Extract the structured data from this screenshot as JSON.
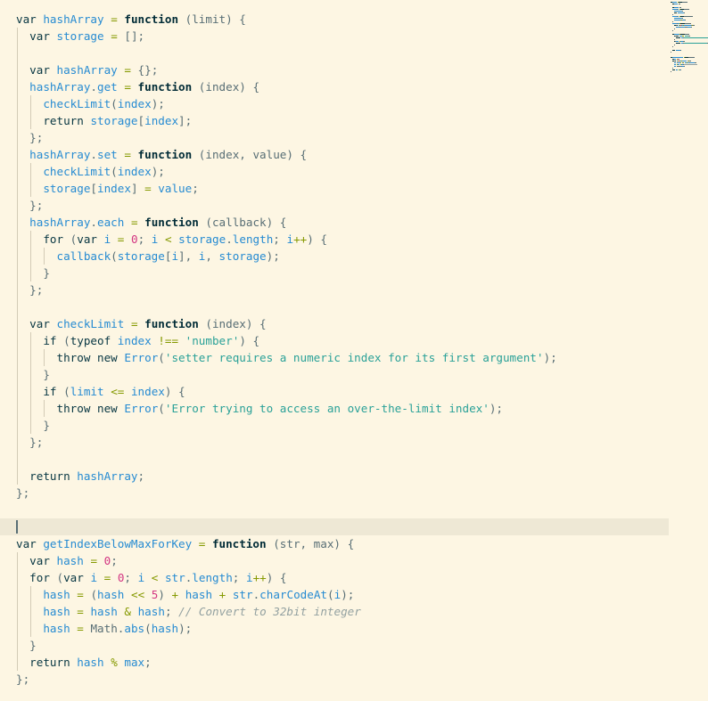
{
  "editor": {
    "theme": "solarized-light",
    "colors": {
      "background": "#fdf6e3",
      "current_line": "#eee8d5",
      "keyword": "#073642",
      "identifier": "#268bd2",
      "string": "#2aa198",
      "number": "#d33682",
      "operator": "#859900",
      "comment": "#93a1a1",
      "text": "#586e75"
    },
    "cursor_line": 30,
    "lines": [
      {
        "indent": 0,
        "tokens": [
          [
            "kw",
            "var"
          ],
          [
            "p",
            " "
          ],
          [
            "id",
            "hashArray"
          ],
          [
            "p",
            " "
          ],
          [
            "op",
            "="
          ],
          [
            "p",
            " "
          ],
          [
            "fk",
            "function"
          ],
          [
            "p",
            " (limit) {"
          ]
        ]
      },
      {
        "indent": 1,
        "tokens": [
          [
            "kw",
            "var"
          ],
          [
            "p",
            " "
          ],
          [
            "id",
            "storage"
          ],
          [
            "p",
            " "
          ],
          [
            "op",
            "="
          ],
          [
            "p",
            " [];"
          ]
        ]
      },
      {
        "indent": 1,
        "tokens": []
      },
      {
        "indent": 1,
        "tokens": [
          [
            "kw",
            "var"
          ],
          [
            "p",
            " "
          ],
          [
            "id",
            "hashArray"
          ],
          [
            "p",
            " "
          ],
          [
            "op",
            "="
          ],
          [
            "p",
            " {};"
          ]
        ]
      },
      {
        "indent": 1,
        "tokens": [
          [
            "id",
            "hashArray"
          ],
          [
            "p",
            "."
          ],
          [
            "id",
            "get"
          ],
          [
            "p",
            " "
          ],
          [
            "op",
            "="
          ],
          [
            "p",
            " "
          ],
          [
            "fk",
            "function"
          ],
          [
            "p",
            " (index) {"
          ]
        ]
      },
      {
        "indent": 2,
        "tokens": [
          [
            "id",
            "checkLimit"
          ],
          [
            "p",
            "("
          ],
          [
            "id",
            "index"
          ],
          [
            "p",
            ");"
          ]
        ]
      },
      {
        "indent": 2,
        "tokens": [
          [
            "kw",
            "return"
          ],
          [
            "p",
            " "
          ],
          [
            "id",
            "storage"
          ],
          [
            "p",
            "["
          ],
          [
            "id",
            "index"
          ],
          [
            "p",
            "];"
          ]
        ]
      },
      {
        "indent": 1,
        "tokens": [
          [
            "p",
            "};"
          ]
        ]
      },
      {
        "indent": 1,
        "tokens": [
          [
            "id",
            "hashArray"
          ],
          [
            "p",
            "."
          ],
          [
            "id",
            "set"
          ],
          [
            "p",
            " "
          ],
          [
            "op",
            "="
          ],
          [
            "p",
            " "
          ],
          [
            "fk",
            "function"
          ],
          [
            "p",
            " (index, value) {"
          ]
        ]
      },
      {
        "indent": 2,
        "tokens": [
          [
            "id",
            "checkLimit"
          ],
          [
            "p",
            "("
          ],
          [
            "id",
            "index"
          ],
          [
            "p",
            ");"
          ]
        ]
      },
      {
        "indent": 2,
        "tokens": [
          [
            "id",
            "storage"
          ],
          [
            "p",
            "["
          ],
          [
            "id",
            "index"
          ],
          [
            "p",
            "] "
          ],
          [
            "op",
            "="
          ],
          [
            "p",
            " "
          ],
          [
            "id",
            "value"
          ],
          [
            "p",
            ";"
          ]
        ]
      },
      {
        "indent": 1,
        "tokens": [
          [
            "p",
            "};"
          ]
        ]
      },
      {
        "indent": 1,
        "tokens": [
          [
            "id",
            "hashArray"
          ],
          [
            "p",
            "."
          ],
          [
            "id",
            "each"
          ],
          [
            "p",
            " "
          ],
          [
            "op",
            "="
          ],
          [
            "p",
            " "
          ],
          [
            "fk",
            "function"
          ],
          [
            "p",
            " (callback) {"
          ]
        ]
      },
      {
        "indent": 2,
        "tokens": [
          [
            "kw",
            "for"
          ],
          [
            "p",
            " ("
          ],
          [
            "kw",
            "var"
          ],
          [
            "p",
            " "
          ],
          [
            "id",
            "i"
          ],
          [
            "p",
            " "
          ],
          [
            "op",
            "="
          ],
          [
            "p",
            " "
          ],
          [
            "num",
            "0"
          ],
          [
            "p",
            "; "
          ],
          [
            "id",
            "i"
          ],
          [
            "p",
            " "
          ],
          [
            "op",
            "<"
          ],
          [
            "p",
            " "
          ],
          [
            "id",
            "storage"
          ],
          [
            "p",
            "."
          ],
          [
            "id",
            "length"
          ],
          [
            "p",
            "; "
          ],
          [
            "id",
            "i"
          ],
          [
            "op",
            "++"
          ],
          [
            "p",
            ") {"
          ]
        ]
      },
      {
        "indent": 3,
        "tokens": [
          [
            "id",
            "callback"
          ],
          [
            "p",
            "("
          ],
          [
            "id",
            "storage"
          ],
          [
            "p",
            "["
          ],
          [
            "id",
            "i"
          ],
          [
            "p",
            "], "
          ],
          [
            "id",
            "i"
          ],
          [
            "p",
            ", "
          ],
          [
            "id",
            "storage"
          ],
          [
            "p",
            ");"
          ]
        ]
      },
      {
        "indent": 2,
        "tokens": [
          [
            "p",
            "}"
          ]
        ]
      },
      {
        "indent": 1,
        "tokens": [
          [
            "p",
            "};"
          ]
        ]
      },
      {
        "indent": 1,
        "tokens": []
      },
      {
        "indent": 1,
        "tokens": [
          [
            "kw",
            "var"
          ],
          [
            "p",
            " "
          ],
          [
            "id",
            "checkLimit"
          ],
          [
            "p",
            " "
          ],
          [
            "op",
            "="
          ],
          [
            "p",
            " "
          ],
          [
            "fk",
            "function"
          ],
          [
            "p",
            " (index) {"
          ]
        ]
      },
      {
        "indent": 2,
        "tokens": [
          [
            "kw",
            "if"
          ],
          [
            "p",
            " ("
          ],
          [
            "kw",
            "typeof"
          ],
          [
            "p",
            " "
          ],
          [
            "id",
            "index"
          ],
          [
            "p",
            " "
          ],
          [
            "op",
            "!=="
          ],
          [
            "p",
            " "
          ],
          [
            "str",
            "'number'"
          ],
          [
            "p",
            ") {"
          ]
        ]
      },
      {
        "indent": 3,
        "tokens": [
          [
            "kw",
            "throw"
          ],
          [
            "p",
            " "
          ],
          [
            "kw",
            "new"
          ],
          [
            "p",
            " "
          ],
          [
            "id",
            "Error"
          ],
          [
            "p",
            "("
          ],
          [
            "str",
            "'setter requires a numeric index for its first argument'"
          ],
          [
            "p",
            ");"
          ]
        ]
      },
      {
        "indent": 2,
        "tokens": [
          [
            "p",
            "}"
          ]
        ]
      },
      {
        "indent": 2,
        "tokens": [
          [
            "kw",
            "if"
          ],
          [
            "p",
            " ("
          ],
          [
            "id",
            "limit"
          ],
          [
            "p",
            " "
          ],
          [
            "op",
            "<="
          ],
          [
            "p",
            " "
          ],
          [
            "id",
            "index"
          ],
          [
            "p",
            ") {"
          ]
        ]
      },
      {
        "indent": 3,
        "tokens": [
          [
            "kw",
            "throw"
          ],
          [
            "p",
            " "
          ],
          [
            "kw",
            "new"
          ],
          [
            "p",
            " "
          ],
          [
            "id",
            "Error"
          ],
          [
            "p",
            "("
          ],
          [
            "str",
            "'Error trying to access an over-the-limit index'"
          ],
          [
            "p",
            ");"
          ]
        ]
      },
      {
        "indent": 2,
        "tokens": [
          [
            "p",
            "}"
          ]
        ]
      },
      {
        "indent": 1,
        "tokens": [
          [
            "p",
            "};"
          ]
        ]
      },
      {
        "indent": 1,
        "tokens": []
      },
      {
        "indent": 1,
        "tokens": [
          [
            "kw",
            "return"
          ],
          [
            "p",
            " "
          ],
          [
            "id",
            "hashArray"
          ],
          [
            "p",
            ";"
          ]
        ]
      },
      {
        "indent": 0,
        "tokens": [
          [
            "p",
            "};"
          ]
        ]
      },
      {
        "indent": 0,
        "tokens": []
      },
      {
        "indent": 0,
        "tokens": []
      },
      {
        "indent": 0,
        "tokens": [
          [
            "kw",
            "var"
          ],
          [
            "p",
            " "
          ],
          [
            "id",
            "getIndexBelowMaxForKey"
          ],
          [
            "p",
            " "
          ],
          [
            "op",
            "="
          ],
          [
            "p",
            " "
          ],
          [
            "fk",
            "function"
          ],
          [
            "p",
            " (str, max) {"
          ]
        ]
      },
      {
        "indent": 1,
        "tokens": [
          [
            "kw",
            "var"
          ],
          [
            "p",
            " "
          ],
          [
            "id",
            "hash"
          ],
          [
            "p",
            " "
          ],
          [
            "op",
            "="
          ],
          [
            "p",
            " "
          ],
          [
            "num",
            "0"
          ],
          [
            "p",
            ";"
          ]
        ]
      },
      {
        "indent": 1,
        "tokens": [
          [
            "kw",
            "for"
          ],
          [
            "p",
            " ("
          ],
          [
            "kw",
            "var"
          ],
          [
            "p",
            " "
          ],
          [
            "id",
            "i"
          ],
          [
            "p",
            " "
          ],
          [
            "op",
            "="
          ],
          [
            "p",
            " "
          ],
          [
            "num",
            "0"
          ],
          [
            "p",
            "; "
          ],
          [
            "id",
            "i"
          ],
          [
            "p",
            " "
          ],
          [
            "op",
            "<"
          ],
          [
            "p",
            " "
          ],
          [
            "id",
            "str"
          ],
          [
            "p",
            "."
          ],
          [
            "id",
            "length"
          ],
          [
            "p",
            "; "
          ],
          [
            "id",
            "i"
          ],
          [
            "op",
            "++"
          ],
          [
            "p",
            ") {"
          ]
        ]
      },
      {
        "indent": 2,
        "tokens": [
          [
            "id",
            "hash"
          ],
          [
            "p",
            " "
          ],
          [
            "op",
            "="
          ],
          [
            "p",
            " ("
          ],
          [
            "id",
            "hash"
          ],
          [
            "p",
            " "
          ],
          [
            "op",
            "<<"
          ],
          [
            "p",
            " "
          ],
          [
            "num",
            "5"
          ],
          [
            "p",
            ") "
          ],
          [
            "op",
            "+"
          ],
          [
            "p",
            " "
          ],
          [
            "id",
            "hash"
          ],
          [
            "p",
            " "
          ],
          [
            "op",
            "+"
          ],
          [
            "p",
            " "
          ],
          [
            "id",
            "str"
          ],
          [
            "p",
            "."
          ],
          [
            "id",
            "charCodeAt"
          ],
          [
            "p",
            "("
          ],
          [
            "id",
            "i"
          ],
          [
            "p",
            ");"
          ]
        ]
      },
      {
        "indent": 2,
        "tokens": [
          [
            "id",
            "hash"
          ],
          [
            "p",
            " "
          ],
          [
            "op",
            "="
          ],
          [
            "p",
            " "
          ],
          [
            "id",
            "hash"
          ],
          [
            "p",
            " "
          ],
          [
            "op",
            "&"
          ],
          [
            "p",
            " "
          ],
          [
            "id",
            "hash"
          ],
          [
            "p",
            "; "
          ],
          [
            "cmt",
            "// Convert to 32bit integer"
          ]
        ]
      },
      {
        "indent": 2,
        "tokens": [
          [
            "id",
            "hash"
          ],
          [
            "p",
            " "
          ],
          [
            "op",
            "="
          ],
          [
            "p",
            " Math."
          ],
          [
            "id",
            "abs"
          ],
          [
            "p",
            "("
          ],
          [
            "id",
            "hash"
          ],
          [
            "p",
            ");"
          ]
        ]
      },
      {
        "indent": 1,
        "tokens": [
          [
            "p",
            "}"
          ]
        ]
      },
      {
        "indent": 1,
        "tokens": [
          [
            "kw",
            "return"
          ],
          [
            "p",
            " "
          ],
          [
            "id",
            "hash"
          ],
          [
            "p",
            " "
          ],
          [
            "op",
            "%"
          ],
          [
            "p",
            " "
          ],
          [
            "id",
            "max"
          ],
          [
            "p",
            ";"
          ]
        ]
      },
      {
        "indent": 0,
        "tokens": [
          [
            "p",
            "};"
          ]
        ]
      }
    ]
  }
}
